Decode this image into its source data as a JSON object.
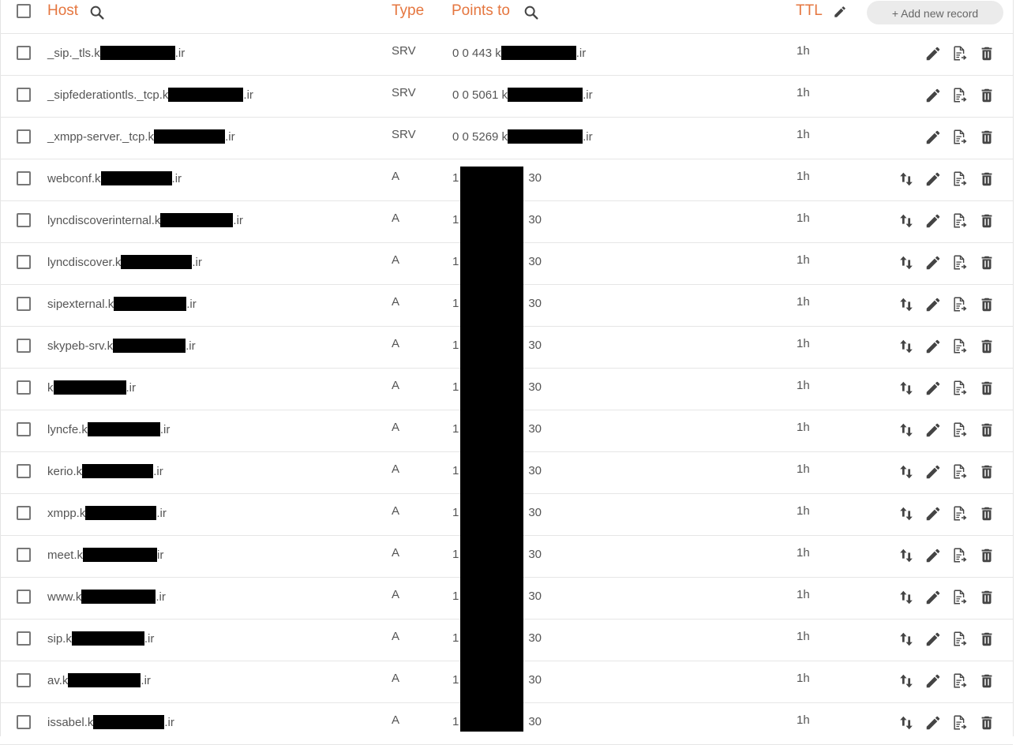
{
  "header": {
    "host_label": "Host",
    "type_label": "Type",
    "points_to_label": "Points to",
    "ttl_label": "TTL",
    "add_button_label": "+ Add new record",
    "search_icon": "search-icon",
    "edit_icon": "pencil-icon",
    "accent_color": "#e5763f"
  },
  "records": [
    {
      "host_prefix": "_sip._tls.k",
      "host_suffix": ".ir",
      "type": "SRV",
      "points_prefix": "0 0 443 k",
      "points_suffix": ".ir",
      "ttl": "1h"
    },
    {
      "host_prefix": "_sipfederationtls._tcp.k",
      "host_suffix": ".ir",
      "type": "SRV",
      "points_prefix": "0 0 5061 k",
      "points_suffix": ".ir",
      "ttl": "1h"
    },
    {
      "host_prefix": "_xmpp-server._tcp.k",
      "host_suffix": ".ir",
      "type": "SRV",
      "points_prefix": "0 0 5269 k",
      "points_suffix": ".ir",
      "ttl": "1h"
    },
    {
      "host_prefix": "webconf.k",
      "host_suffix": ".ir",
      "type": "A",
      "points_prefix": "1",
      "points_suffix": "30",
      "ttl": "1h"
    },
    {
      "host_prefix": "lyncdiscoverinternal.k",
      "host_suffix": ".ir",
      "type": "A",
      "points_prefix": "1",
      "points_suffix": "30",
      "ttl": "1h"
    },
    {
      "host_prefix": "lyncdiscover.k",
      "host_suffix": ".ir",
      "type": "A",
      "points_prefix": "1",
      "points_suffix": "30",
      "ttl": "1h"
    },
    {
      "host_prefix": "sipexternal.k",
      "host_suffix": ".ir",
      "type": "A",
      "points_prefix": "1",
      "points_suffix": "30",
      "ttl": "1h"
    },
    {
      "host_prefix": "skypeb-srv.k",
      "host_suffix": ".ir",
      "type": "A",
      "points_prefix": "1",
      "points_suffix": "30",
      "ttl": "1h"
    },
    {
      "host_prefix": "k",
      "host_suffix": ".ir",
      "type": "A",
      "points_prefix": "1",
      "points_suffix": "30",
      "ttl": "1h"
    },
    {
      "host_prefix": "lyncfe.k",
      "host_suffix": ".ir",
      "type": "A",
      "points_prefix": "1",
      "points_suffix": "30",
      "ttl": "1h"
    },
    {
      "host_prefix": "kerio.k",
      "host_suffix": ".ir",
      "type": "A",
      "points_prefix": "1",
      "points_suffix": "30",
      "ttl": "1h"
    },
    {
      "host_prefix": "xmpp.k",
      "host_suffix": ".ir",
      "type": "A",
      "points_prefix": "1",
      "points_suffix": "30",
      "ttl": "1h"
    },
    {
      "host_prefix": "meet.k",
      "host_suffix": "ir",
      "type": "A",
      "points_prefix": "1",
      "points_suffix": "30",
      "ttl": "1h"
    },
    {
      "host_prefix": "www.k",
      "host_suffix": ".ir",
      "type": "A",
      "points_prefix": "1",
      "points_suffix": "30",
      "ttl": "1h"
    },
    {
      "host_prefix": "sip.k",
      "host_suffix": ".ir",
      "type": "A",
      "points_prefix": "1",
      "points_suffix": "30",
      "ttl": "1h"
    },
    {
      "host_prefix": "av.k",
      "host_suffix": ".ir",
      "type": "A",
      "points_prefix": "1",
      "points_suffix": "30",
      "ttl": "1h"
    },
    {
      "host_prefix": "issabel.k",
      "host_suffix": ".ir",
      "type": "A",
      "points_prefix": "1",
      "points_suffix": "30",
      "ttl": "1h"
    }
  ],
  "row_icons": [
    "swap-priority-icon",
    "pencil-icon",
    "duplicate-record-icon",
    "trash-icon"
  ]
}
